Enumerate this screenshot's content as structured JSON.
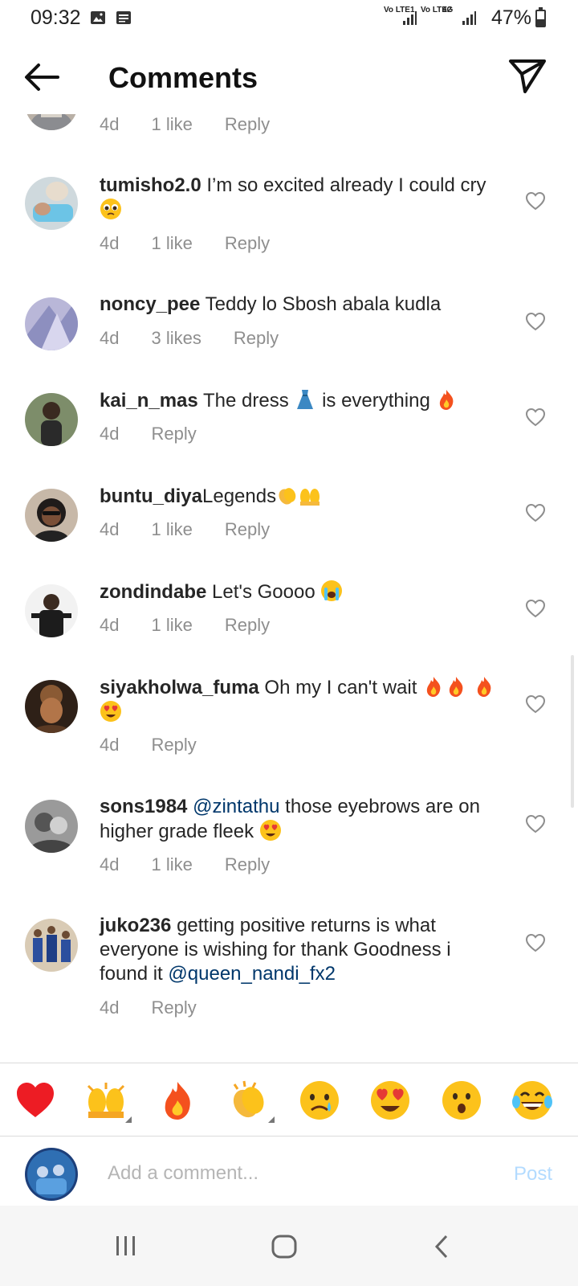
{
  "status_bar": {
    "time": "09:32",
    "battery": "47%",
    "battery_level": 0.47,
    "sim1_label": "Vo LTE1",
    "sim2_label": "Vo LTE2",
    "network": "4G"
  },
  "header": {
    "title": "Comments"
  },
  "comments": [
    {
      "username": "",
      "text": "",
      "age": "4d",
      "likes": "1 like",
      "reply": "Reply"
    },
    {
      "username": "tumisho2.0",
      "text": "I’m so excited already I could cry",
      "age": "4d",
      "likes": "1 like",
      "reply": "Reply"
    },
    {
      "username": "noncy_pee",
      "text": "Teddy lo Sbosh abala kudla",
      "age": "4d",
      "likes": "3 likes",
      "reply": "Reply"
    },
    {
      "username": "kai_n_mas",
      "text_a": "The dress",
      "text_b": "is everything",
      "age": "4d",
      "reply": "Reply"
    },
    {
      "username": "buntu_diya",
      "text": "Legends",
      "age": "4d",
      "likes": "1 like",
      "reply": "Reply"
    },
    {
      "username": "zondindabe",
      "text": "Let's Goooo",
      "age": "4d",
      "likes": "1 like",
      "reply": "Reply"
    },
    {
      "username": "siyakholwa_fuma",
      "text": "Oh my I can't wait",
      "age": "4d",
      "reply": "Reply"
    },
    {
      "username": "sons1984",
      "mention": "@zintathu",
      "text": "those eyebrows are on higher grade fleek",
      "age": "4d",
      "likes": "1 like",
      "reply": "Reply"
    },
    {
      "username": "juko236",
      "text": "getting positive returns is what everyone is wishing for thank Goodness i found it",
      "mention": "@queen_nandi_fx2",
      "age": "4d",
      "reply": "Reply"
    }
  ],
  "emoji_bar": [
    "heart",
    "raised-hands",
    "fire",
    "clapping-hands",
    "crying-face",
    "heart-eyes",
    "surprised-face",
    "tears-of-joy"
  ],
  "compose": {
    "placeholder": "Add a comment...",
    "post_label": "Post"
  },
  "colors": {
    "link": "#00376b",
    "muted": "#8e8e8e",
    "post_disabled": "#b3dbff"
  }
}
